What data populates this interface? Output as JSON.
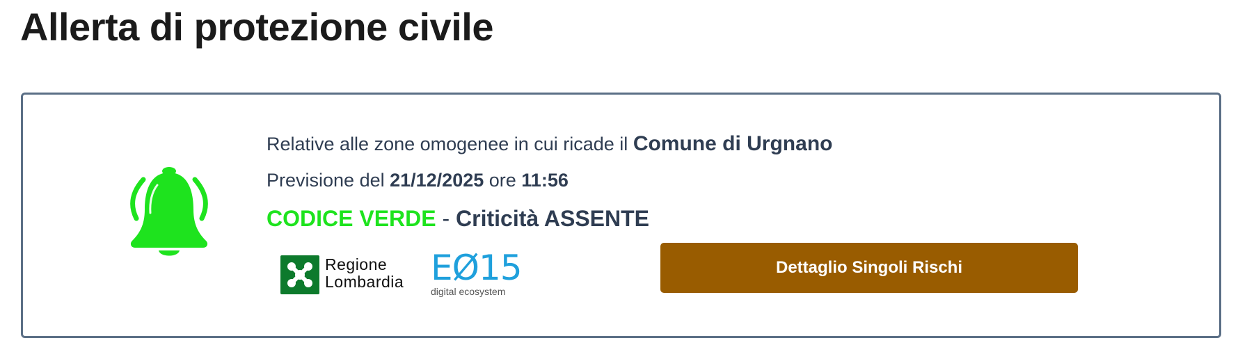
{
  "page": {
    "title": "Allerta di protezione civile"
  },
  "alert": {
    "zone_prefix": "Relative alle zone omogenee in cui ricade il ",
    "comune": "Comune di Urgnano",
    "forecast_prefix": "Previsione del ",
    "forecast_date": "21/12/2025",
    "forecast_time_prefix": " ore ",
    "forecast_time": "11:56",
    "code_label": "CODICE VERDE",
    "code_separator": " - ",
    "criticality": "Criticità ASSENTE",
    "bell_icon": "bell-icon",
    "code_color": "#1ee31e"
  },
  "logos": {
    "lombardia_line1": "Regione",
    "lombardia_line2": "Lombardia",
    "e015_mark": "EØ15",
    "e015_sub": "digital ecosystem"
  },
  "actions": {
    "detail_button_label": "Dettaglio Singoli Rischi",
    "detail_button_color": "#995c00"
  }
}
